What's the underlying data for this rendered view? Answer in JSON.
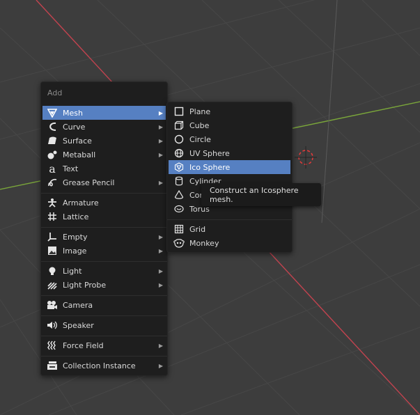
{
  "add_menu": {
    "title": "Add",
    "items": [
      {
        "label": "Mesh",
        "icon": "mesh-icon",
        "submenu": true,
        "active": true
      },
      {
        "label": "Curve",
        "icon": "curve-icon",
        "submenu": true
      },
      {
        "label": "Surface",
        "icon": "surface-icon",
        "submenu": true
      },
      {
        "label": "Metaball",
        "icon": "metaball-icon",
        "submenu": true
      },
      {
        "label": "Text",
        "icon": "text-icon",
        "submenu": false
      },
      {
        "label": "Grease Pencil",
        "icon": "grease-pencil-icon",
        "submenu": true
      },
      {
        "label": "Armature",
        "icon": "armature-icon",
        "submenu": false
      },
      {
        "label": "Lattice",
        "icon": "lattice-icon",
        "submenu": false
      },
      {
        "label": "Empty",
        "icon": "empty-icon",
        "submenu": true
      },
      {
        "label": "Image",
        "icon": "image-icon",
        "submenu": true
      },
      {
        "label": "Light",
        "icon": "light-icon",
        "submenu": true
      },
      {
        "label": "Light Probe",
        "icon": "light-probe-icon",
        "submenu": true
      },
      {
        "label": "Camera",
        "icon": "camera-icon",
        "submenu": false
      },
      {
        "label": "Speaker",
        "icon": "speaker-icon",
        "submenu": false
      },
      {
        "label": "Force Field",
        "icon": "force-field-icon",
        "submenu": true
      },
      {
        "label": "Collection Instance",
        "icon": "collection-instance-icon",
        "submenu": true
      }
    ]
  },
  "mesh_menu": {
    "items": [
      {
        "label": "Plane",
        "icon": "plane-icon"
      },
      {
        "label": "Cube",
        "icon": "cube-icon"
      },
      {
        "label": "Circle",
        "icon": "circle-icon"
      },
      {
        "label": "UV Sphere",
        "icon": "uv-sphere-icon"
      },
      {
        "label": "Ico Sphere",
        "icon": "ico-sphere-icon",
        "active": true
      },
      {
        "label": "Cylinder",
        "icon": "cylinder-icon"
      },
      {
        "label": "Con",
        "icon": "cone-icon"
      },
      {
        "label": "Torus",
        "icon": "torus-icon"
      },
      {
        "label": "Grid",
        "icon": "grid-icon"
      },
      {
        "label": "Monkey",
        "icon": "monkey-icon"
      }
    ]
  },
  "tooltip": {
    "text": "Construct an Icosphere mesh."
  },
  "colors": {
    "highlight": "#5680c2",
    "menu_bg": "#1e1e1e",
    "viewport_bg": "#3d3d3d",
    "x_axis": "#c2434f",
    "y_axis": "#7aa63a",
    "cursor": "#e83a3a"
  }
}
